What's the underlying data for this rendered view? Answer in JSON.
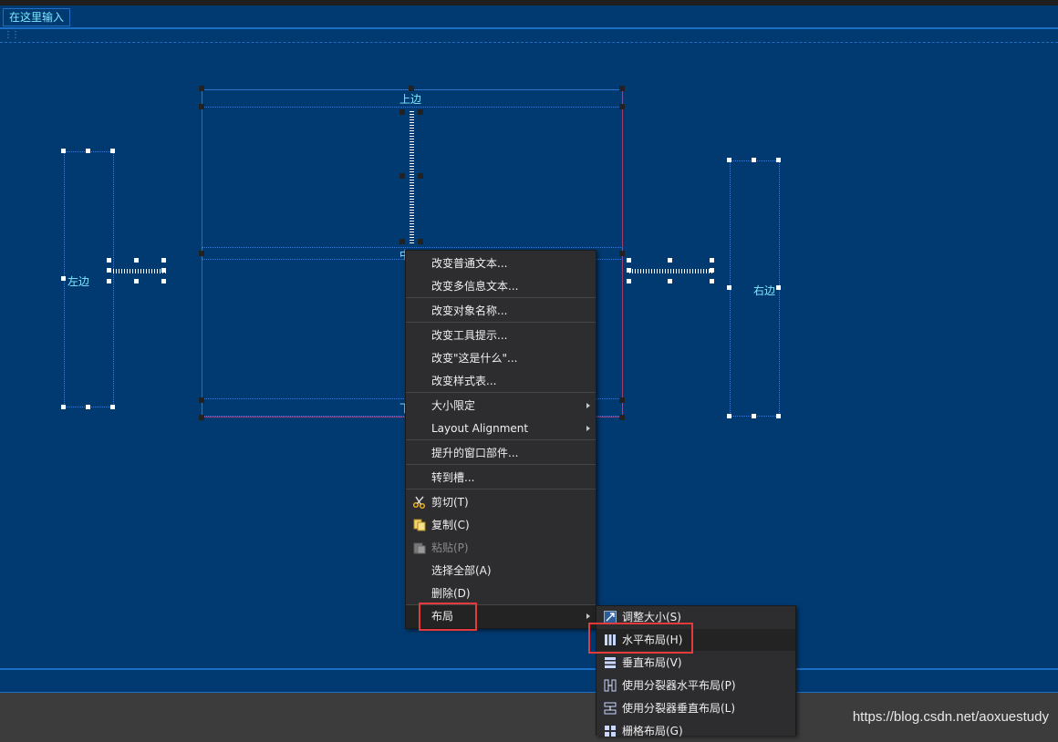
{
  "menubar": {
    "placeholder_item": "在这里输入"
  },
  "canvas": {
    "label_top": "上边",
    "label_left": "左边",
    "label_right": "右边",
    "label_center": "中",
    "label_bottom": "下"
  },
  "context_menu": {
    "items": [
      {
        "label": "改变普通文本..."
      },
      {
        "label": "改变多信息文本..."
      },
      {
        "label": "改变对象名称..."
      },
      {
        "label": "改变工具提示..."
      },
      {
        "label": "改变\"这是什么\"..."
      },
      {
        "label": "改变样式表..."
      },
      {
        "label": "大小限定"
      },
      {
        "label": "Layout Alignment"
      },
      {
        "label": "提升的窗口部件..."
      },
      {
        "label": "转到槽..."
      },
      {
        "label": "剪切(T)",
        "icon": "scissors-icon"
      },
      {
        "label": "复制(C)",
        "icon": "copy-icon"
      },
      {
        "label": "粘贴(P)",
        "icon": "paste-icon",
        "disabled": true
      },
      {
        "label": "选择全部(A)"
      },
      {
        "label": "删除(D)"
      },
      {
        "label": "布局"
      }
    ]
  },
  "submenu": {
    "items": [
      {
        "label": "调整大小(S)",
        "icon": "adjust-size-icon"
      },
      {
        "label": "水平布局(H)",
        "icon": "horizontal-layout-icon"
      },
      {
        "label": "垂直布局(V)",
        "icon": "vertical-layout-icon"
      },
      {
        "label": "使用分裂器水平布局(P)",
        "icon": "splitter-horizontal-icon"
      },
      {
        "label": "使用分裂器垂直布局(L)",
        "icon": "splitter-vertical-icon"
      },
      {
        "label": "栅格布局(G)",
        "icon": "grid-layout-icon"
      }
    ]
  },
  "colors": {
    "accent_red": "#e23b3b",
    "canvas_blue": "#003a70",
    "label_cyan": "#7fe8ff"
  },
  "watermark": "https://blog.csdn.net/aoxuestudy"
}
